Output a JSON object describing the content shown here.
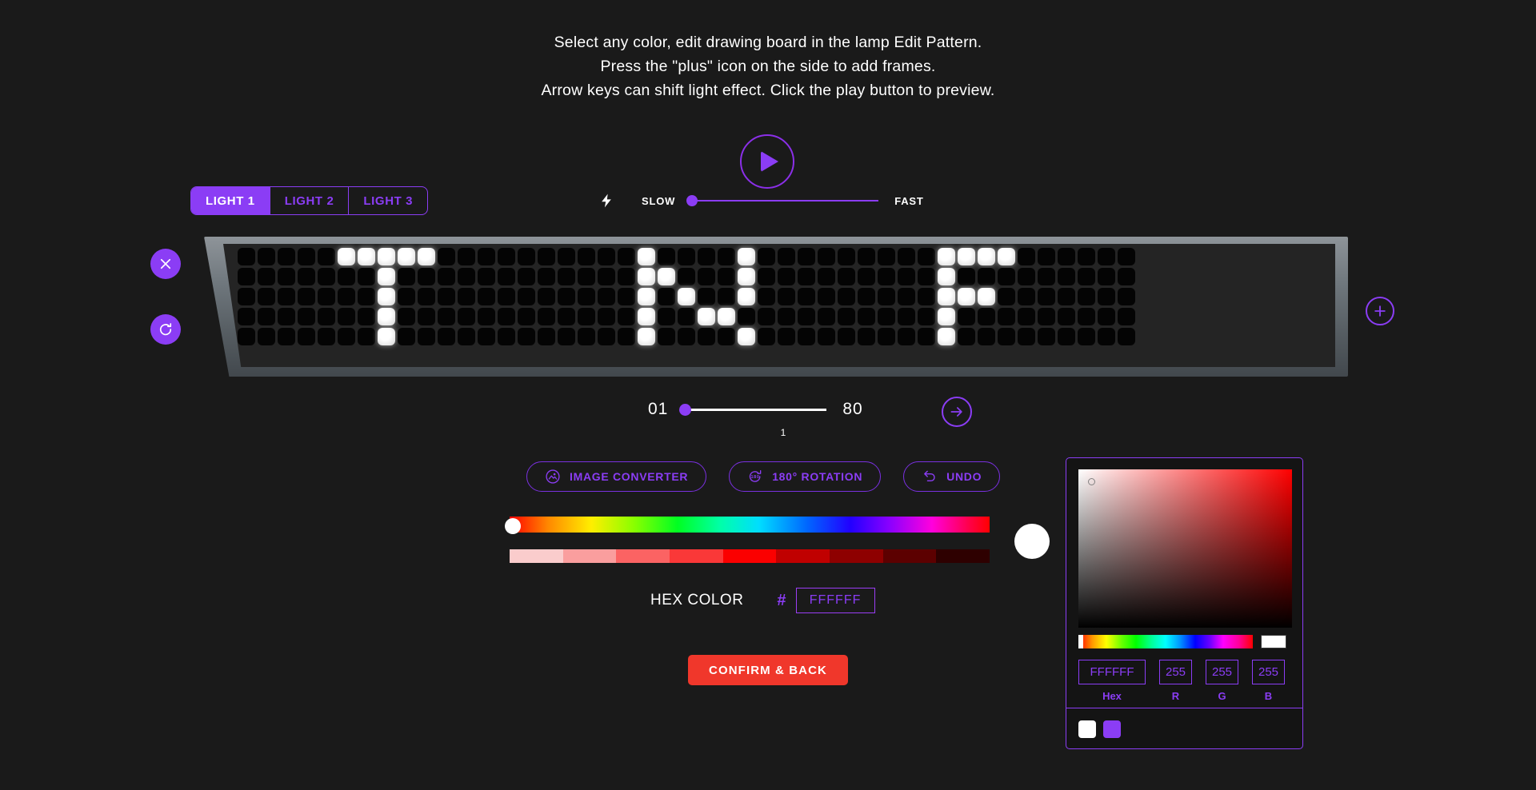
{
  "instructions": {
    "line1": "Select any color, edit drawing board in the lamp Edit Pattern.",
    "line2": "Press the \"plus\" icon on the side to add frames.",
    "line3": "Arrow keys can shift light effect. Click the play button to preview."
  },
  "playback": {
    "play_label": "play"
  },
  "light_tabs": [
    {
      "label": "LIGHT 1",
      "active": true
    },
    {
      "label": "LIGHT 2",
      "active": false
    },
    {
      "label": "LIGHT 3",
      "active": false
    }
  ],
  "speed": {
    "min_label": "SLOW",
    "max_label": "FAST",
    "value": 0,
    "icon": "lightning-bolt-icon"
  },
  "side_controls": {
    "close_label": "Close",
    "reset_label": "Reset",
    "add_frame_label": "Add frame"
  },
  "led_panel": {
    "rows": 5,
    "cols": 45,
    "on_color": "#FFFFFF",
    "off_color": "#040404",
    "pixels": [
      [
        0,
        0,
        0,
        0,
        0,
        1,
        1,
        1,
        1,
        1,
        0,
        0,
        0,
        0,
        0,
        0,
        0,
        0,
        0,
        0,
        1,
        0,
        0,
        0,
        0,
        1,
        0,
        0,
        0,
        0,
        0,
        0,
        0,
        0,
        0,
        1,
        1,
        1,
        1,
        0,
        0,
        0,
        0,
        0,
        0
      ],
      [
        0,
        0,
        0,
        0,
        0,
        0,
        0,
        1,
        0,
        0,
        0,
        0,
        0,
        0,
        0,
        0,
        0,
        0,
        0,
        0,
        1,
        1,
        0,
        0,
        0,
        1,
        0,
        0,
        0,
        0,
        0,
        0,
        0,
        0,
        0,
        1,
        0,
        0,
        0,
        0,
        0,
        0,
        0,
        0,
        0
      ],
      [
        0,
        0,
        0,
        0,
        0,
        0,
        0,
        1,
        0,
        0,
        0,
        0,
        0,
        0,
        0,
        0,
        0,
        0,
        0,
        0,
        1,
        0,
        1,
        0,
        0,
        1,
        0,
        0,
        0,
        0,
        0,
        0,
        0,
        0,
        0,
        1,
        1,
        1,
        0,
        0,
        0,
        0,
        0,
        0,
        0
      ],
      [
        0,
        0,
        0,
        0,
        0,
        0,
        0,
        1,
        0,
        0,
        0,
        0,
        0,
        0,
        0,
        0,
        0,
        0,
        0,
        0,
        1,
        0,
        0,
        1,
        1,
        0,
        0,
        0,
        0,
        0,
        0,
        0,
        0,
        0,
        0,
        1,
        0,
        0,
        0,
        0,
        0,
        0,
        0,
        0,
        0
      ],
      [
        0,
        0,
        0,
        0,
        0,
        0,
        0,
        1,
        0,
        0,
        0,
        0,
        0,
        0,
        0,
        0,
        0,
        0,
        0,
        0,
        1,
        0,
        0,
        0,
        0,
        1,
        0,
        0,
        0,
        0,
        0,
        0,
        0,
        0,
        0,
        1,
        0,
        0,
        0,
        0,
        0,
        0,
        0,
        0,
        0
      ]
    ]
  },
  "frame_slider": {
    "start_label": "01",
    "end_label": "80",
    "current_value": "1",
    "next_label": "Next frame"
  },
  "tools": [
    {
      "label": "IMAGE CONVERTER",
      "icon": "image-icon"
    },
    {
      "label": "180° ROTATION",
      "icon": "rotate-180-icon"
    },
    {
      "label": "UNDO",
      "icon": "undo-icon"
    }
  ],
  "color_strips": {
    "hue_value": 0,
    "shades": [
      "#FACCCC",
      "#FA9E9E",
      "#FB6363",
      "#FA3838",
      "#FB0000",
      "#C00000",
      "#8E0000",
      "#5C0000",
      "#2E0000"
    ],
    "preview": "#FFFFFF"
  },
  "hex_color": {
    "label": "HEX COLOR",
    "hash": "#",
    "value": "FFFFFF",
    "placeholder": "FFFFFF"
  },
  "confirm": {
    "label": "CONFIRM & BACK",
    "color": "#F0372B"
  },
  "picker": {
    "hex": {
      "value": "FFFFFF",
      "label": "Hex",
      "placeholder": "FFFFFF"
    },
    "r": {
      "value": "255",
      "label": "R",
      "placeholder": "255"
    },
    "g": {
      "value": "255",
      "label": "G",
      "placeholder": "255"
    },
    "b": {
      "value": "255",
      "label": "B",
      "placeholder": "255"
    },
    "recent_swatches": [
      "#FFFFFF",
      "#8B3DF5"
    ]
  },
  "theme": {
    "accent": "#8B3DF5",
    "background": "#1A1A1A",
    "danger": "#F0372B"
  }
}
